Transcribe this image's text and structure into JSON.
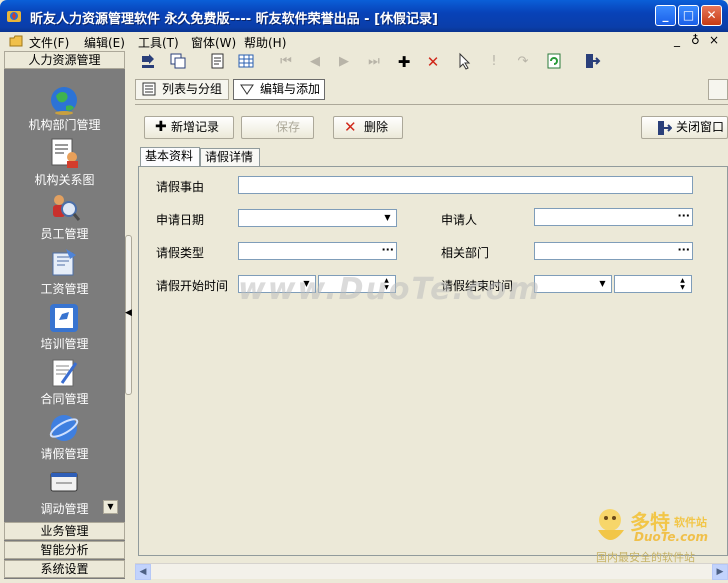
{
  "window": {
    "title": "昕友人力资源管理软件 永久免费版---- 昕友软件荣誉出品 - [休假记录]",
    "min_label": "_",
    "max_label": "□",
    "close_label": "✕"
  },
  "menu": {
    "items": [
      "文件(F)",
      "编辑(E)",
      "工具(T)",
      "窗体(W)",
      "帮助(H)"
    ],
    "right_controls": [
      "_",
      "♁",
      "×"
    ]
  },
  "sidebar": {
    "header": "人力资源管理",
    "items": [
      {
        "label": "机构部门管理",
        "icon": "globe-icon"
      },
      {
        "label": "机构关系图",
        "icon": "org-chart-icon"
      },
      {
        "label": "员工管理",
        "icon": "employee-icon"
      },
      {
        "label": "工资管理",
        "icon": "salary-icon"
      },
      {
        "label": "培训管理",
        "icon": "training-icon"
      },
      {
        "label": "合同管理",
        "icon": "contract-icon"
      },
      {
        "label": "请假管理",
        "icon": "leave-icon"
      },
      {
        "label": "调动管理",
        "icon": "transfer-icon"
      }
    ],
    "footer": [
      "业务管理",
      "智能分析",
      "系统设置"
    ]
  },
  "view_tabs": {
    "list": "列表与分组",
    "edit": "编辑与添加"
  },
  "actions": {
    "add": "新增记录",
    "save": "保存",
    "delete": "删除",
    "close": "关闭窗口"
  },
  "form_tabs": {
    "basic": "基本资料",
    "detail": "请假详情"
  },
  "form": {
    "reason_label": "请假事由",
    "apply_date_label": "申请日期",
    "applicant_label": "申请人",
    "type_label": "请假类型",
    "dept_label": "相关部门",
    "start_label": "请假开始时间",
    "end_label": "请假结束时间",
    "reason_value": "",
    "apply_date_value": "",
    "applicant_value": "",
    "type_value": "",
    "dept_value": "",
    "start_date_value": "",
    "start_time_value": "",
    "end_date_value": "",
    "end_time_value": ""
  },
  "watermark": "www.DuoTe.com",
  "corner_logo": {
    "brand": "多特",
    "brand_suffix": "软件站",
    "url": "DuoTe.com",
    "tagline": "国内最安全的软件站"
  }
}
